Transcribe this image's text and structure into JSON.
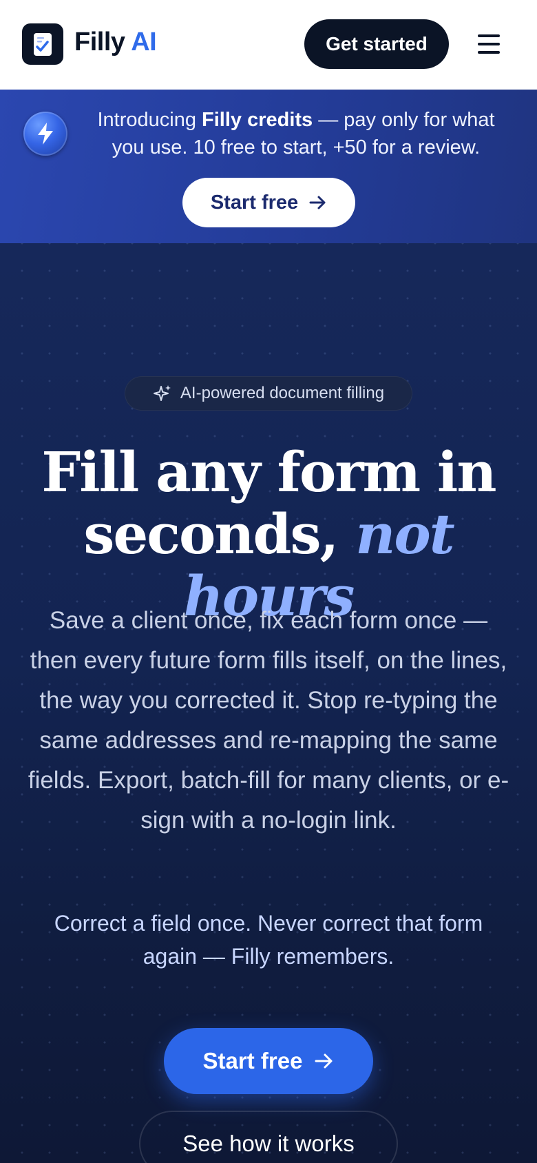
{
  "header": {
    "brand_name": "Filly",
    "brand_suffix": "AI",
    "get_started_label": "Get started",
    "menu_icon": "hamburger-menu-icon",
    "logo_icon": "checklist-document-icon"
  },
  "banner": {
    "icon": "lightning-bolt-icon",
    "text_pre": "Introducing ",
    "text_bold": "Filly credits",
    "text_post": " — pay only for what you use. 10 free to start, +50 for a review.",
    "button_label": "Start free",
    "button_icon": "arrow-right-icon"
  },
  "hero": {
    "pill_icon": "sparkles-icon",
    "pill_label": "AI-powered document filling",
    "headline_main": "Fill any form in seconds, ",
    "headline_accent": "not hours",
    "subtext": "Save a client once, fix each form once — then every future form fills itself, on the lines, the way you corrected it. Stop re-typing the same addresses and re-mapping the same fields. Export, batch-fill for many clients, or e-sign with a no-login link.",
    "tagline": "Correct a field once. Never correct that form again — Filly remembers.",
    "cta_label": "Start free",
    "cta_icon": "arrow-right-icon",
    "secondary_label": "See how it works"
  },
  "colors": {
    "accent_blue": "#2c66e8",
    "brand_ai": "#2f6bea",
    "navy": "#0b1426",
    "headline_accent": "#8fb0ff",
    "banner_bg": "#2b47b0"
  }
}
